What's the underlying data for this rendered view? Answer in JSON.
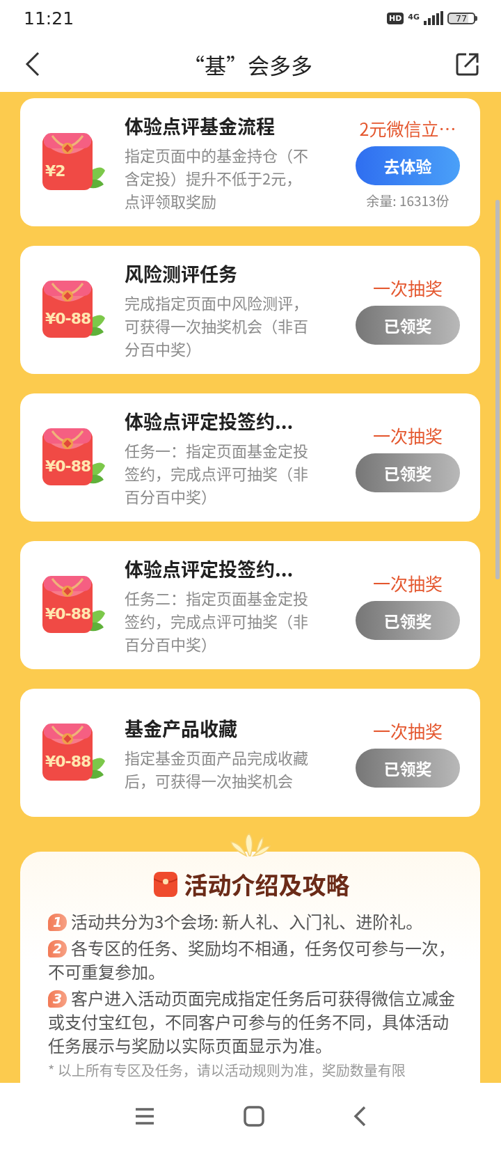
{
  "status_bar": {
    "time": "11:21",
    "hd": "HD",
    "network": "4G",
    "battery": "77"
  },
  "header": {
    "title": "“基”会多多"
  },
  "tasks": [
    {
      "title": "体验点评基金流程",
      "description": "指定页面中的基金持仓（不含定投）提升不低于2元，点评领取奖励",
      "amount": "¥2",
      "reward": "2元微信立…",
      "button": {
        "label": "去体验",
        "kind": "active"
      },
      "stock": "余量: 16313份"
    },
    {
      "title": "风险测评任务",
      "description": "完成指定页面中风险测评，可获得一次抽奖机会（非百分百中奖）",
      "amount": "¥0-88",
      "reward": "一次抽奖",
      "button": {
        "label": "已领奖",
        "kind": "claimed"
      }
    },
    {
      "title": "体验点评定投签约...",
      "description": "任务一：指定页面基金定投签约，完成点评可抽奖（非百分百中奖）",
      "amount": "¥0-88",
      "reward": "一次抽奖",
      "button": {
        "label": "已领奖",
        "kind": "claimed"
      }
    },
    {
      "title": "体验点评定投签约...",
      "description": "任务二：指定页面基金定投签约，完成点评可抽奖（非百分百中奖）",
      "amount": "¥0-88",
      "reward": "一次抽奖",
      "button": {
        "label": "已领奖",
        "kind": "claimed"
      }
    },
    {
      "title": "基金产品收藏",
      "description": "指定基金页面产品完成收藏后，可获得一次抽奖机会",
      "amount": "¥0-88",
      "reward": "一次抽奖",
      "button": {
        "label": "已领奖",
        "kind": "claimed"
      }
    }
  ],
  "intro": {
    "title": "活动介绍及攻略",
    "items": [
      {
        "number": "1",
        "text": "活动共分为3个会场: 新人礼、入门礼、进阶礼。"
      },
      {
        "number": "2",
        "text": "各专区的任务、奖励均不相通，任务仅可参与一次，不可重复参加。"
      },
      {
        "number": "3",
        "text": "客户进入活动页面完成指定任务后可获得微信立减金或支付宝红包，不同客户可参与的任务不同，具体活动任务展示与奖励以实际页面显示为准。"
      }
    ],
    "note": "* 以上所有专区及任务，请以活动规则为准，奖励数量有限"
  }
}
